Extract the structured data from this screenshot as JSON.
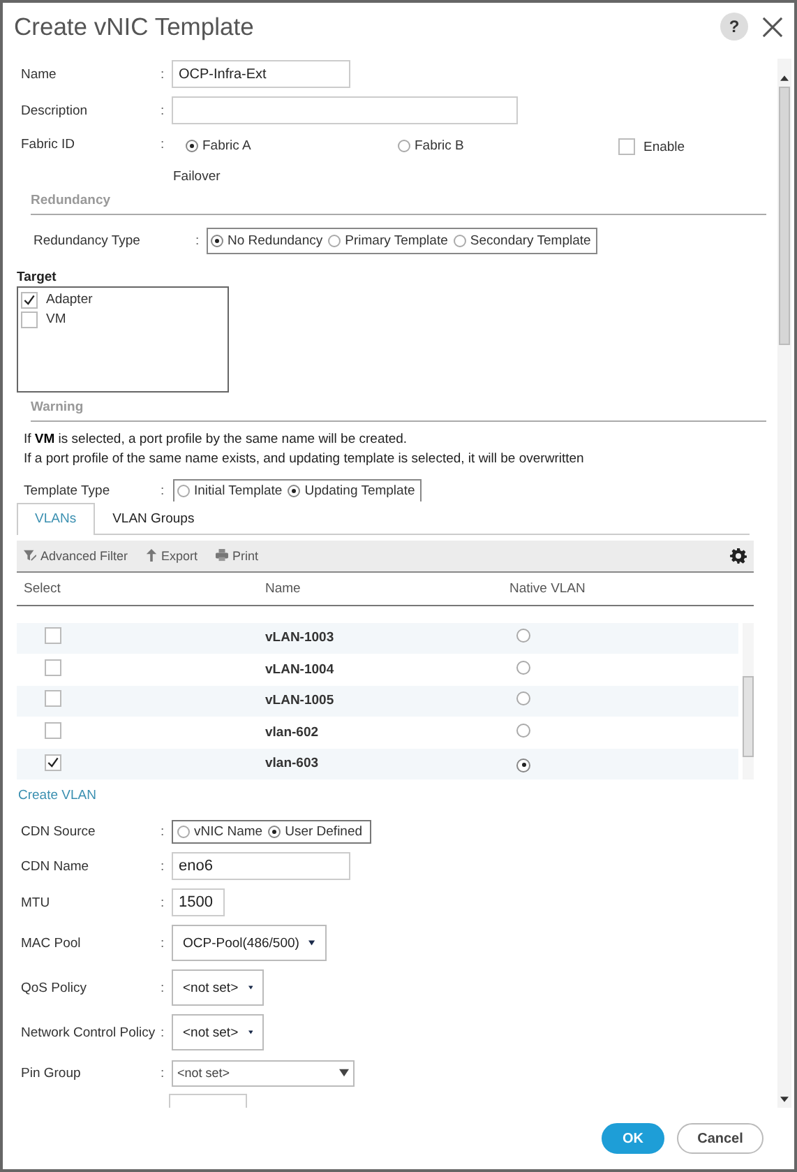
{
  "dialog": {
    "title": "Create vNIC Template",
    "help": "?"
  },
  "name": {
    "label": "Name",
    "colon": ":",
    "value": "OCP-Infra-Ext"
  },
  "description": {
    "label": "Description",
    "colon": ":"
  },
  "fabric_id": {
    "label": "Fabric ID",
    "colon": ":",
    "options": [
      {
        "label": "Fabric A",
        "selected": true
      },
      {
        "label": "Fabric B",
        "selected": false
      }
    ],
    "failover": {
      "label": "Enable",
      "label_2": "Failover",
      "checked": false
    }
  },
  "redundancy": {
    "heading": "Redundancy",
    "label": "Redundancy Type",
    "colon": ":",
    "options": [
      {
        "label": "No Redundancy",
        "selected": true
      },
      {
        "label": "Primary Template",
        "selected": false
      },
      {
        "label": "Secondary Template",
        "selected": false
      }
    ]
  },
  "target": {
    "heading": "Target",
    "items": [
      {
        "label": "Adapter",
        "checked": true
      },
      {
        "label": "VM",
        "checked": false
      }
    ]
  },
  "warning": {
    "heading": "Warning",
    "lines": [
      "If **VM** is selected, a port profile by the same name will be created.",
      "If a port profile of the same name exists, and updating template is selected, it will be overwritten"
    ]
  },
  "template_type": {
    "label": "Template Type",
    "colon": ":",
    "options": [
      {
        "label": "Initial Template",
        "selected": false
      },
      {
        "label": "Updating Template",
        "selected": true
      }
    ]
  },
  "tabs": [
    {
      "label": "VLANs",
      "selected": true
    },
    {
      "label": "VLAN Groups",
      "selected": false
    }
  ],
  "toolbar": [
    {
      "kind": "filter",
      "label": "Advanced Filter"
    },
    {
      "kind": "export",
      "label": "Export"
    },
    {
      "kind": "print",
      "label": "Print"
    }
  ],
  "vlan_table": {
    "columns": [
      "Select",
      "Name",
      "Native VLAN"
    ],
    "rows": [
      {
        "name": "vLAN-1003",
        "checked": false,
        "native": false
      },
      {
        "name": "vLAN-1004",
        "checked": false,
        "native": false
      },
      {
        "name": "vLAN-1005",
        "checked": false,
        "native": false
      },
      {
        "name": "vlan-602",
        "checked": false,
        "native": false
      },
      {
        "name": "vlan-603",
        "checked": true,
        "native": true
      }
    ]
  },
  "create_vlan": "Create VLAN",
  "cdn_source": {
    "label": "CDN Source",
    "colon": ":",
    "options": [
      {
        "label": "vNIC Name",
        "selected": false
      },
      {
        "label": "User Defined",
        "selected": true
      }
    ]
  },
  "cdn_name": {
    "label": "CDN Name",
    "colon": ":",
    "value": "eno6"
  },
  "mtu": {
    "label": "MTU",
    "colon": ":",
    "value": "1500"
  },
  "mac_pool": {
    "label": "MAC Pool",
    "colon": ":",
    "value": "OCP-Pool(486/500)"
  },
  "qos_policy": {
    "label": "QoS Policy",
    "colon": ":",
    "value": "<not set>"
  },
  "network_control_policy": {
    "label": "Network Control Policy",
    "colon": ":",
    "value": "<not set>"
  },
  "pin_group": {
    "label": "Pin Group",
    "colon": ":",
    "value": "<not set>"
  },
  "buttons": [
    {
      "label": "OK",
      "kind": "primary"
    },
    {
      "label": "Cancel",
      "kind": "secondary"
    }
  ]
}
